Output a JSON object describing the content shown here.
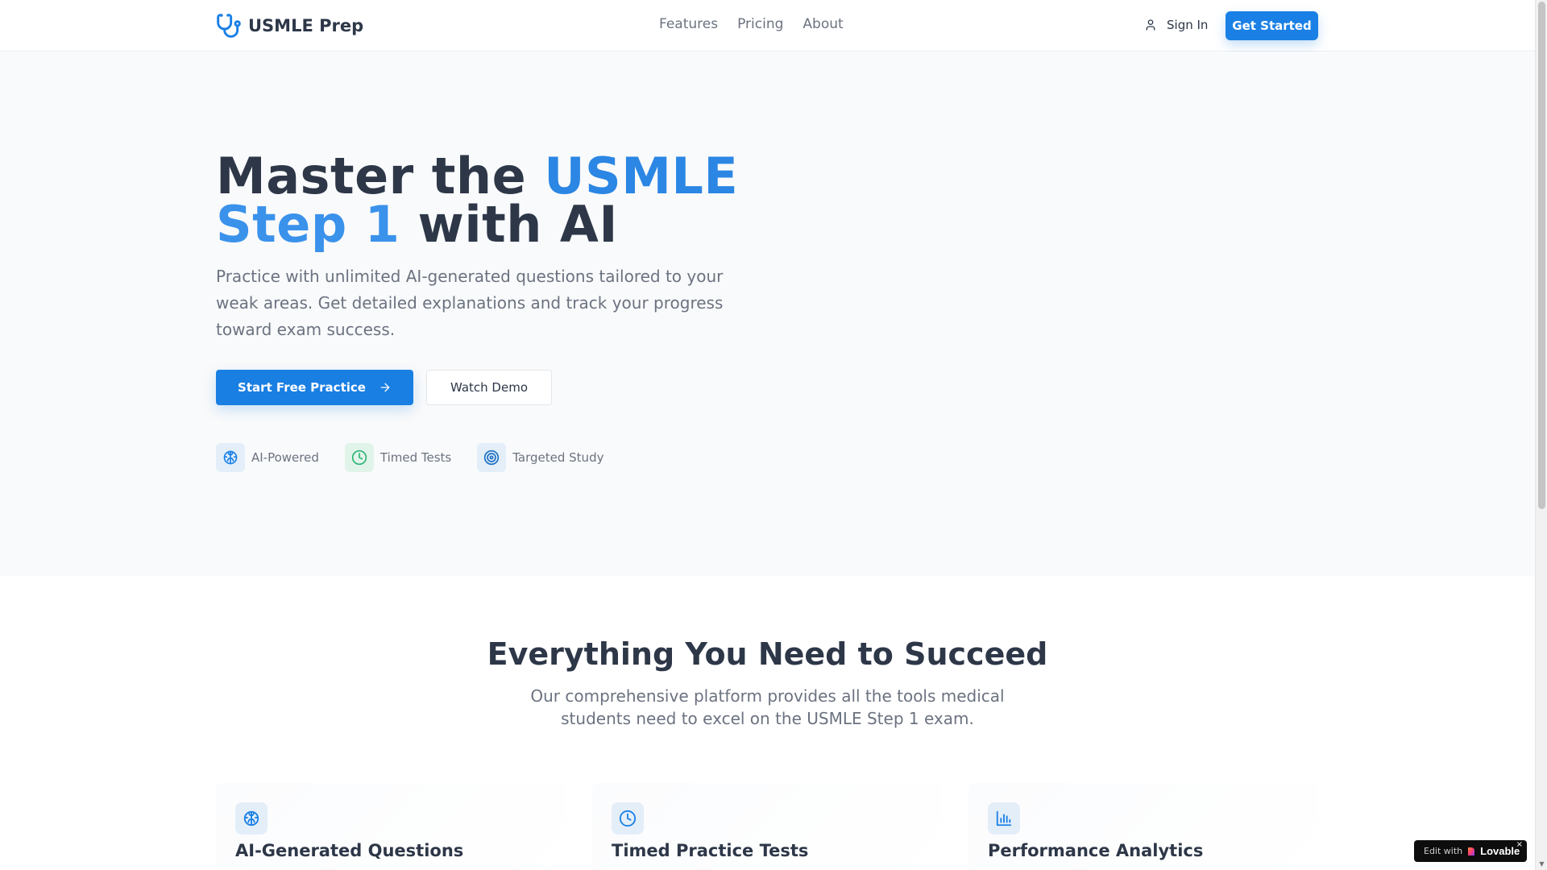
{
  "header": {
    "logo_text": "USMLE Prep",
    "nav": [
      "Features",
      "Pricing",
      "About"
    ],
    "sign_in": "Sign In",
    "get_started": "Get Started"
  },
  "hero": {
    "title_part1": "Master the ",
    "title_accent1": "USMLE",
    "title_accent2": "Step 1",
    "title_part2": " with AI",
    "subtitle": "Practice with unlimited AI-generated questions tailored to your weak areas. Get detailed explanations and track your progress toward exam success.",
    "primary_button": "Start Free Practice",
    "secondary_button": "Watch Demo",
    "badges": [
      {
        "label": "AI-Powered",
        "icon": "brain-icon"
      },
      {
        "label": "Timed Tests",
        "icon": "clock-icon"
      },
      {
        "label": "Targeted Study",
        "icon": "target-icon"
      }
    ]
  },
  "features": {
    "title": "Everything You Need to Succeed",
    "subtitle": "Our comprehensive platform provides all the tools medical students need to excel on the USMLE Step 1 exam.",
    "cards": [
      {
        "title": "AI-Generated Questions",
        "icon": "brain-icon"
      },
      {
        "title": "Timed Practice Tests",
        "icon": "clock-icon"
      },
      {
        "title": "Performance Analytics",
        "icon": "bar-chart-icon"
      }
    ]
  },
  "lovable_badge": {
    "edit_with": "Edit with",
    "brand": "Lovable",
    "close": "×"
  },
  "colors": {
    "primary": "#1a80e5",
    "text": "#2d3748",
    "muted": "#6b7280",
    "hero_bg": "#f9fafb"
  }
}
